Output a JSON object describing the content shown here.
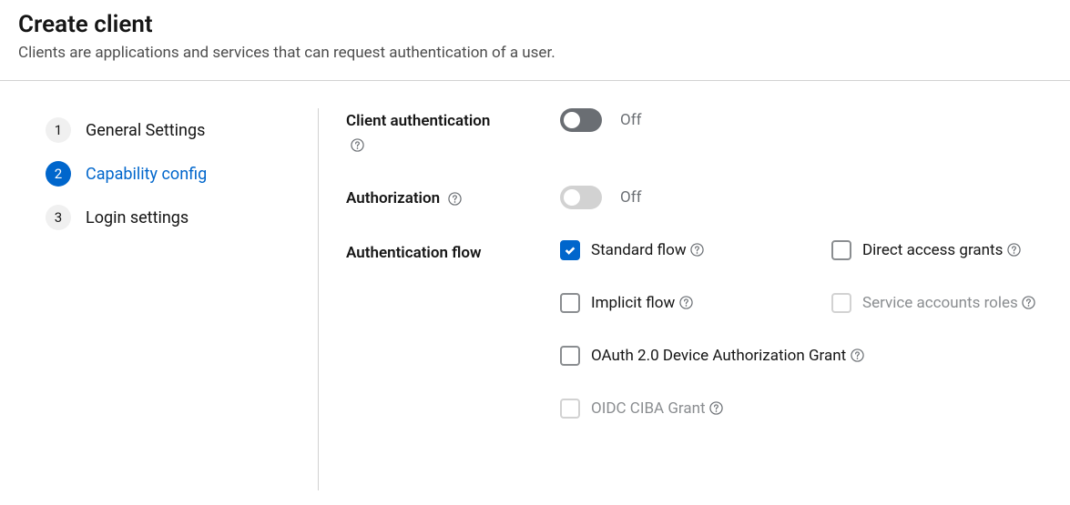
{
  "header": {
    "title": "Create client",
    "description": "Clients are applications and services that can request authentication of a user."
  },
  "stepper": {
    "steps": [
      {
        "num": "1",
        "label": "General Settings",
        "active": false
      },
      {
        "num": "2",
        "label": "Capability config",
        "active": true
      },
      {
        "num": "3",
        "label": "Login settings",
        "active": false
      }
    ]
  },
  "form": {
    "clientAuth": {
      "label": "Client authentication",
      "value": "Off"
    },
    "authorization": {
      "label": "Authorization",
      "value": "Off"
    },
    "authFlow": {
      "label": "Authentication flow",
      "options": {
        "standard": {
          "label": "Standard flow"
        },
        "direct": {
          "label": "Direct access grants"
        },
        "implicit": {
          "label": "Implicit flow"
        },
        "service": {
          "label": "Service accounts roles"
        },
        "oauth": {
          "label": "OAuth 2.0 Device Authorization Grant"
        },
        "ciba": {
          "label": "OIDC CIBA Grant"
        }
      }
    }
  }
}
